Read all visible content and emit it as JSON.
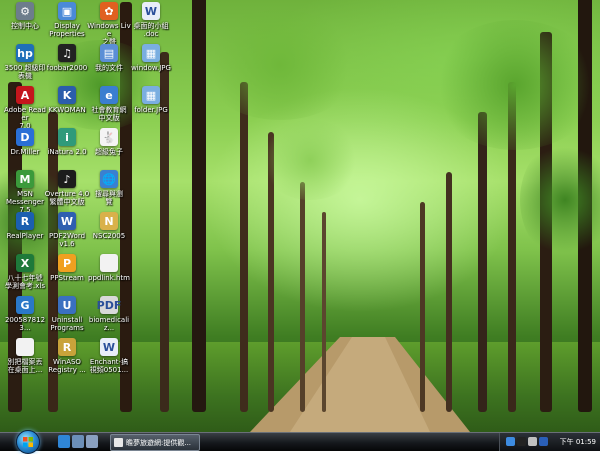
{
  "desktop": {
    "icons": [
      {
        "label": "控制中心",
        "icon": "control-center-icon",
        "color": "#6d7d8c",
        "glyph": "⚙"
      },
      {
        "label": "3500 超級印\n表機",
        "icon": "printer-hp-icon",
        "color": "#1f6fb8",
        "glyph": "hp"
      },
      {
        "label": "Adobe Reader\n7.0",
        "icon": "adobe-reader-icon",
        "color": "#c4161c",
        "glyph": "A"
      },
      {
        "label": "Dr.Miller",
        "icon": "dr-miller-icon",
        "color": "#2a6fd6",
        "glyph": "D"
      },
      {
        "label": "MSN\nMessenger 7.5",
        "icon": "msn-messenger-icon",
        "color": "#3b9a3b",
        "glyph": "M"
      },
      {
        "label": "RealPlayer",
        "icon": "realplayer-icon",
        "color": "#1b5fb0",
        "glyph": "R"
      },
      {
        "label": "八十七年號\n學測會考.xls",
        "icon": "excel-file-icon",
        "color": "#1e7a3a",
        "glyph": "X"
      },
      {
        "label": "2005878123...",
        "icon": "image-file-icon",
        "color": "#2a78c8",
        "glyph": "G"
      },
      {
        "label": "別把檔案丟\n在桌面上...",
        "icon": "text-file-icon",
        "color": "#f2f2f2",
        "glyph": ""
      },
      {
        "label": "Display\nProperties",
        "icon": "display-properties-icon",
        "color": "#4a8ad8",
        "glyph": "▣"
      },
      {
        "label": "foobar2000",
        "icon": "foobar2000-icon",
        "color": "#222222",
        "glyph": "♫"
      },
      {
        "label": "KKWOMAN",
        "icon": "kkwoman-icon",
        "color": "#2b5dab",
        "glyph": "K"
      },
      {
        "label": "iNatura 2.0",
        "icon": "inatura-icon",
        "color": "#2f9a7a",
        "glyph": "i"
      },
      {
        "label": "Overture 4.0\n繁體中文版",
        "icon": "overture-icon",
        "color": "#1c1c1c",
        "glyph": "♪"
      },
      {
        "label": "PDF2Word\nv1.6",
        "icon": "pdf2word-icon",
        "color": "#2f5fb0",
        "glyph": "W"
      },
      {
        "label": "PPStream",
        "icon": "ppstream-icon",
        "color": "#f0a020",
        "glyph": "P"
      },
      {
        "label": "Uninstall\nPrograms",
        "icon": "uninstall-icon",
        "color": "#3a70c0",
        "glyph": "U"
      },
      {
        "label": "WinASO\nRegistry ...",
        "icon": "winaso-icon",
        "color": "#c9a33a",
        "glyph": "R"
      },
      {
        "label": "Windows Live\n之聲",
        "icon": "windows-live-icon",
        "color": "#e06020",
        "glyph": "✿"
      },
      {
        "label": "我的文件",
        "icon": "my-documents-icon",
        "color": "#5b8ed6",
        "glyph": "▤"
      },
      {
        "label": "社會教育網\n中文版",
        "icon": "browser-icon",
        "color": "#3a7ed0",
        "glyph": "e"
      },
      {
        "label": "超級兔子",
        "icon": "super-rabbit-icon",
        "color": "#f4f4f4",
        "glyph": "🐇"
      },
      {
        "label": "搜尋與瀏\n覽",
        "icon": "search-browse-icon",
        "color": "#3a80d0",
        "glyph": "🌐"
      },
      {
        "label": "NSC2005",
        "icon": "nsc2005-icon",
        "color": "#d9b14a",
        "glyph": "N"
      },
      {
        "label": "ppdlink.htm",
        "icon": "html-file-icon",
        "color": "#f2f2f2",
        "glyph": ""
      },
      {
        "label": "biomedicaliz...",
        "icon": "pdf-file-icon",
        "color": "#d9d9d9",
        "glyph": "PDF"
      },
      {
        "label": "Enchant-搞\n視頻0501...",
        "icon": "word-file-icon",
        "color": "#e8eef8",
        "glyph": "W"
      },
      {
        "label": "桌面的小組\n.doc",
        "icon": "word-document-icon",
        "color": "#e8eef8",
        "glyph": "W"
      },
      {
        "label": "window.JPG",
        "icon": "jpg-image-icon",
        "color": "#7aaee0",
        "glyph": "▦"
      },
      {
        "label": "folder.JPG",
        "icon": "folder-jpg-icon",
        "color": "#7aaee0",
        "glyph": "▦"
      }
    ]
  },
  "taskbar": {
    "start_label": "Start",
    "quicklaunch": [
      {
        "icon": "ie-quicklaunch-icon",
        "color": "#2f86d6"
      },
      {
        "icon": "desktop-quicklaunch-icon",
        "color": "#6c8fb8"
      },
      {
        "icon": "switch-windows-icon",
        "color": "#8aa0c0"
      }
    ],
    "window_button_label": "瞻夢旅遊網:提供觀...",
    "tray": [
      {
        "icon": "network-tray-icon",
        "color": "#3d8be0"
      },
      {
        "icon": "qq-tray-icon",
        "color": "#222222"
      },
      {
        "icon": "speaker-tray-icon",
        "color": "#c0c0c0"
      },
      {
        "icon": "security-tray-icon",
        "color": "#2a5fb8"
      }
    ],
    "clock": "下午 01:59"
  }
}
